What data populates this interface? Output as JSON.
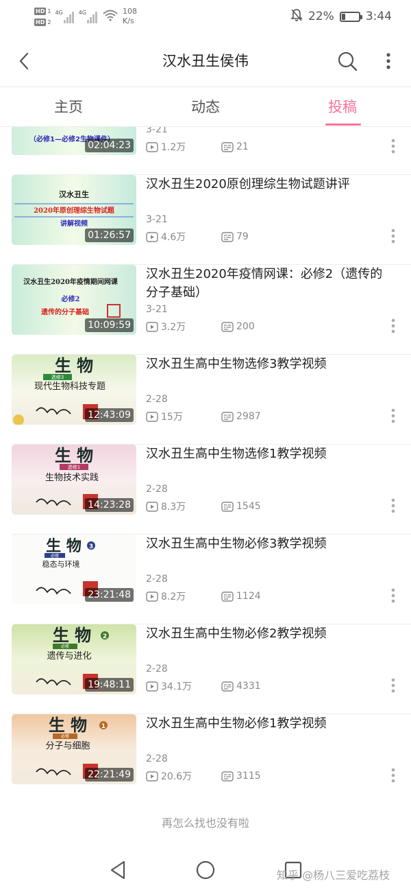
{
  "status_bar": {
    "network_speed_value": "108",
    "network_speed_unit": "K/s",
    "sim1": "HD",
    "sim1_num": "1",
    "sim2": "HD",
    "sim2_num": "2",
    "signal1_gen": "4G",
    "signal2_gen": "4G",
    "battery_percent": "22%",
    "battery_level": 0.22,
    "time": "3:44"
  },
  "header": {
    "title": "汉水丑生侯伟"
  },
  "tabs": [
    {
      "label": "主页",
      "active": false
    },
    {
      "label": "动态",
      "active": false
    },
    {
      "label": "投稿",
      "active": true
    }
  ],
  "videos": [
    {
      "title": "",
      "date": "3-21",
      "plays": "1.2万",
      "danmaku": "21",
      "duration": "02:04:23",
      "thumb_text": [
        "（必修1—必修2生物课件）"
      ]
    },
    {
      "title": "汉水丑生2020原创理综生物试题讲评",
      "date": "3-21",
      "plays": "4.6万",
      "danmaku": "79",
      "duration": "01:26:57",
      "thumb_text": [
        "汉水丑生",
        "2020年原创理综生物试题",
        "讲解视频"
      ]
    },
    {
      "title": "汉水丑生2020年疫情网课：必修2（遗传的分子基础）",
      "date": "3-21",
      "plays": "3.2万",
      "danmaku": "200",
      "duration": "10:09:59",
      "thumb_text": [
        "汉水丑生2020年疫情期间网课",
        "必修2",
        "遗传的分子基础"
      ]
    },
    {
      "title": "汉水丑生高中生物选修3教学视频",
      "date": "2-28",
      "plays": "15万",
      "danmaku": "2987",
      "duration": "12:43:09",
      "thumb_text": [
        "生 物",
        "选修3",
        "现代生物科技专题"
      ]
    },
    {
      "title": "汉水丑生高中生物选修1教学视频",
      "date": "2-28",
      "plays": "8.3万",
      "danmaku": "1545",
      "duration": "14:23:28",
      "thumb_text": [
        "生 物",
        "选修1",
        "生物技术实践"
      ]
    },
    {
      "title": "汉水丑生高中生物必修3教学视频",
      "date": "2-28",
      "plays": "8.2万",
      "danmaku": "1124",
      "duration": "23:21:48",
      "thumb_text": [
        "生 物",
        "必修",
        "稳态与环境"
      ]
    },
    {
      "title": "汉水丑生高中生物必修2教学视频",
      "date": "2-28",
      "plays": "34.1万",
      "danmaku": "4331",
      "duration": "19:48:11",
      "thumb_text": [
        "生 物",
        "必修",
        "遗传与进化"
      ]
    },
    {
      "title": "汉水丑生高中生物必修1教学视频",
      "date": "2-28",
      "plays": "20.6万",
      "danmaku": "3115",
      "duration": "22:21:49",
      "thumb_text": [
        "生 物",
        "必修",
        "分子与细胞"
      ]
    }
  ],
  "end_text": "再怎么找也没有啦",
  "watermark": "知乎 @杨八三爱吃荔枝",
  "colors": {
    "accent": "#fb7299",
    "text": "#222222",
    "muted": "#888888"
  }
}
